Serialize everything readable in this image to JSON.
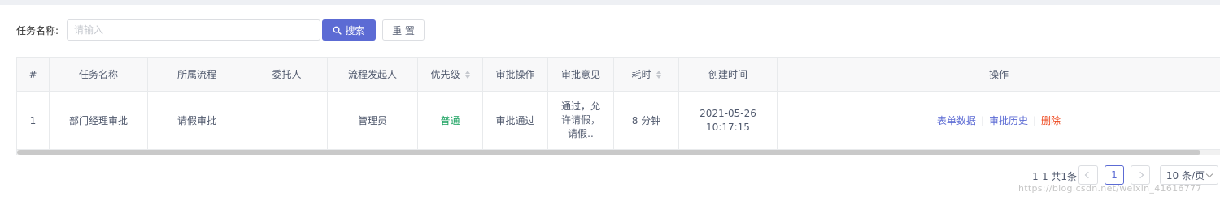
{
  "search": {
    "label": "任务名称:",
    "placeholder": "请输入",
    "value": "",
    "search_button": "搜索",
    "reset_button": "重 置",
    "search_icon": "search-icon"
  },
  "table": {
    "columns": [
      "#",
      "任务名称",
      "所属流程",
      "委托人",
      "流程发起人",
      "优先级",
      "审批操作",
      "审批意见",
      "耗时",
      "创建时间",
      "操作"
    ],
    "sortable_columns": [
      "优先级",
      "耗时"
    ],
    "rows": [
      {
        "index": "1",
        "task_name": "部门经理审批",
        "process": "请假审批",
        "delegate": "",
        "initiator": "管理员",
        "priority": "普通",
        "approval_action": "审批通过",
        "approval_opinion_lines": [
          "通过，允",
          "许请假，",
          "请假.."
        ],
        "duration": "8 分钟",
        "created_date": "2021-05-26",
        "created_time": "10:17:15",
        "actions": [
          "表单数据",
          "审批历史",
          "删除"
        ]
      }
    ]
  },
  "pagination": {
    "total_text": "1-1 共1条",
    "current_page": "1",
    "page_size": "10 条/页"
  },
  "watermark": "https://blog.csdn.net/weixin_41616777",
  "colors": {
    "primary": "#5c6bd4",
    "priority_normal": "#19a15f",
    "danger": "#ed4014"
  }
}
